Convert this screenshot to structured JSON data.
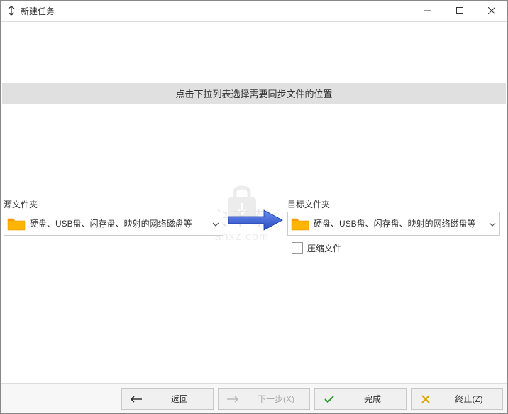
{
  "titlebar": {
    "title": "新建任务"
  },
  "instruction": "点击下拉列表选择需要同步文件的位置",
  "source": {
    "label": "源文件夹",
    "dropdown_text": "硬盘、USB盘、闪存盘、映射的网络磁盘等"
  },
  "target": {
    "label": "目标文件夹",
    "dropdown_text": "硬盘、USB盘、闪存盘、映射的网络磁盘等"
  },
  "compress": {
    "label": "压缩文件"
  },
  "footer": {
    "back": "返回",
    "next": "下一步(X)",
    "finish": "完成",
    "abort": "终止(Z)"
  },
  "watermark": {
    "cn": "安下载",
    "en": "anxz.com"
  }
}
